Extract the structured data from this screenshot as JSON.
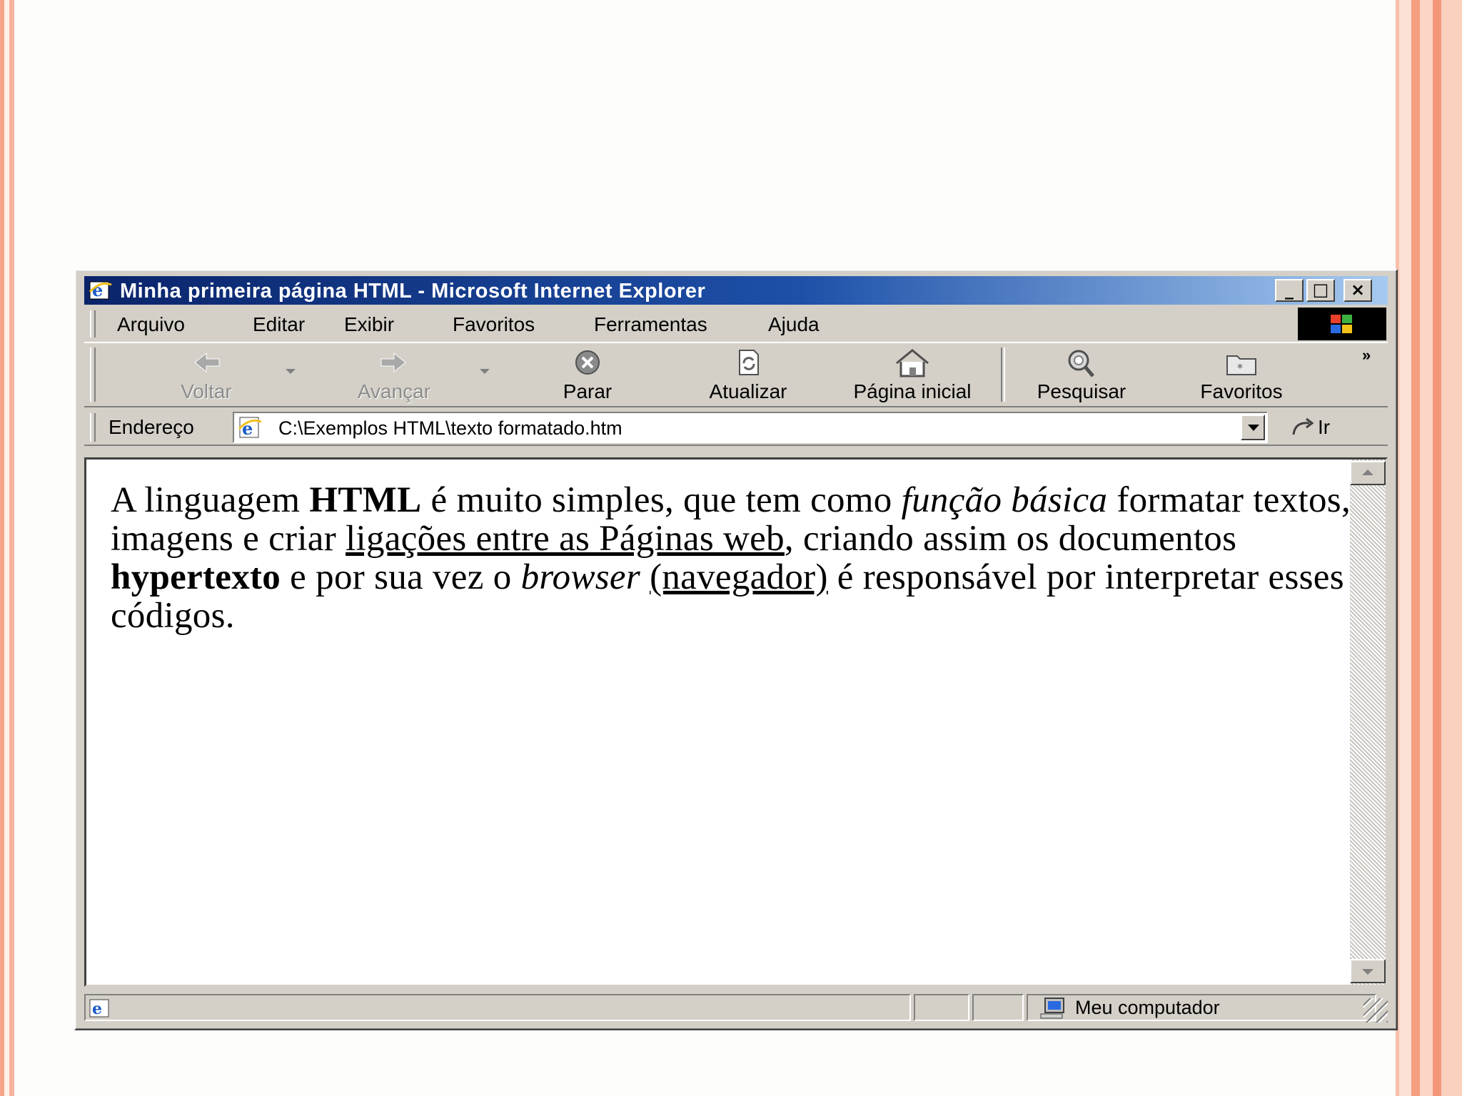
{
  "window": {
    "title": "Minha primeira página HTML - Microsoft Internet Explorer",
    "controls": {
      "minimize": "_",
      "maximize": "□",
      "close": "×"
    }
  },
  "menu": {
    "items": [
      {
        "label": "Arquivo"
      },
      {
        "label": "Editar"
      },
      {
        "label": "Exibir"
      },
      {
        "label": "Favoritos"
      },
      {
        "label": "Ferramentas"
      },
      {
        "label": "Ajuda"
      }
    ]
  },
  "toolbar": {
    "back": {
      "label": "Voltar",
      "icon": "back-arrow-icon",
      "enabled": false
    },
    "forward": {
      "label": "Avançar",
      "icon": "forward-arrow-icon",
      "enabled": false
    },
    "stop": {
      "label": "Parar",
      "icon": "stop-icon"
    },
    "refresh": {
      "label": "Atualizar",
      "icon": "refresh-icon"
    },
    "home": {
      "label": "Página inicial",
      "icon": "home-icon"
    },
    "search": {
      "label": "Pesquisar",
      "icon": "search-icon"
    },
    "favorites": {
      "label": "Favoritos",
      "icon": "favorites-folder-icon"
    },
    "overflow": "»"
  },
  "address": {
    "label": "Endereço",
    "value": "C:\\Exemplos HTML\\texto formatado.htm",
    "go_label": "Ir"
  },
  "page": {
    "p1": "A linguagem ",
    "b1": "HTML",
    "p2": " é muito simples, que tem como ",
    "i1": "função básica",
    "p3": " formatar textos, imagens e criar ",
    "u1": "ligações entre as Páginas web",
    "p4": ", criando assim os documentos ",
    "b2": "hypertexto",
    "p5": " e por sua vez o ",
    "i2": "browser",
    "p6": " ",
    "u2": "(navegador)",
    "p7": " é responsável por interpretar esses códigos."
  },
  "status": {
    "zone_label": "Meu computador"
  },
  "colors": {
    "title_gradient_start": "#0a246a",
    "title_gradient_end": "#a6caf0",
    "chrome": "#d4d0c8",
    "slide_accent": "#f59f80"
  }
}
